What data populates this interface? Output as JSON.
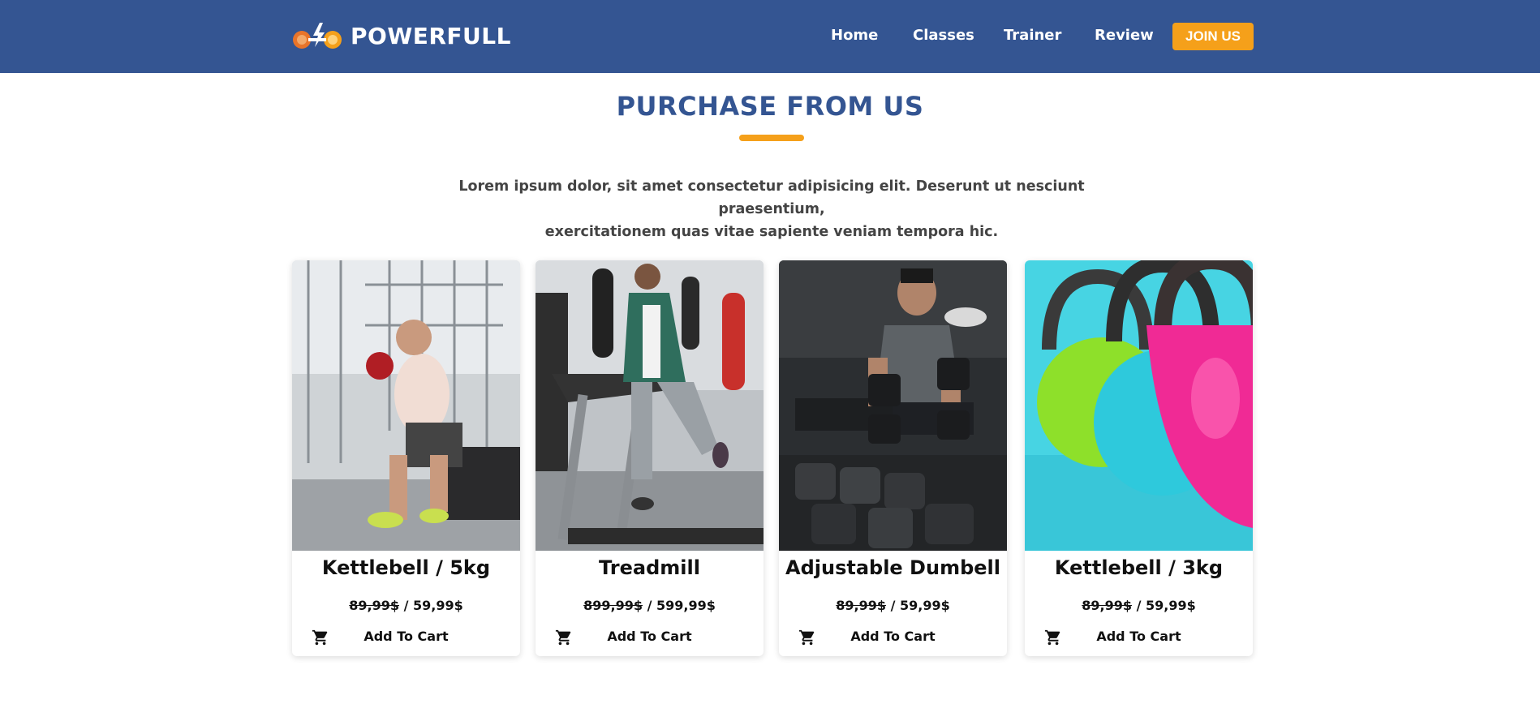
{
  "brand": {
    "name": "POWERFULL",
    "logo_icon": "dumbbell-lightning-logo"
  },
  "nav": {
    "links": [
      {
        "label": "Home"
      },
      {
        "label": "Classes"
      },
      {
        "label": "Trainer"
      },
      {
        "label": "Review"
      }
    ],
    "cta_label": "JOIN US"
  },
  "section": {
    "title": "PURCHASE FROM US",
    "intro_line1": "Lorem ipsum dolor, sit amet consectetur adipisicing elit. Deserunt ut nesciunt praesentium,",
    "intro_line2": "exercitationem quas vitae sapiente veniam tempora hic."
  },
  "products": [
    {
      "name": "Kettlebell / 5kg",
      "old_price": "89,99$",
      "separator": " / ",
      "new_price": "59,99$",
      "cart_label": "Add To Cart",
      "cart_icon": "cart-icon"
    },
    {
      "name": "Treadmill",
      "old_price": "899,99$",
      "separator": " / ",
      "new_price": "599,99$",
      "cart_label": "Add To Cart",
      "cart_icon": "cart-icon"
    },
    {
      "name": "Adjustable Dumbell",
      "old_price": "89,99$",
      "separator": " / ",
      "new_price": "59,99$",
      "cart_label": "Add To Cart",
      "cart_icon": "cart-icon"
    },
    {
      "name": "Kettlebell / 3kg",
      "old_price": "89,99$",
      "separator": " / ",
      "new_price": "59,99$",
      "cart_label": "Add To Cart",
      "cart_icon": "cart-icon"
    }
  ],
  "colors": {
    "nav_bg": "#345592",
    "accent": "#f5a01a",
    "title": "#345592"
  }
}
